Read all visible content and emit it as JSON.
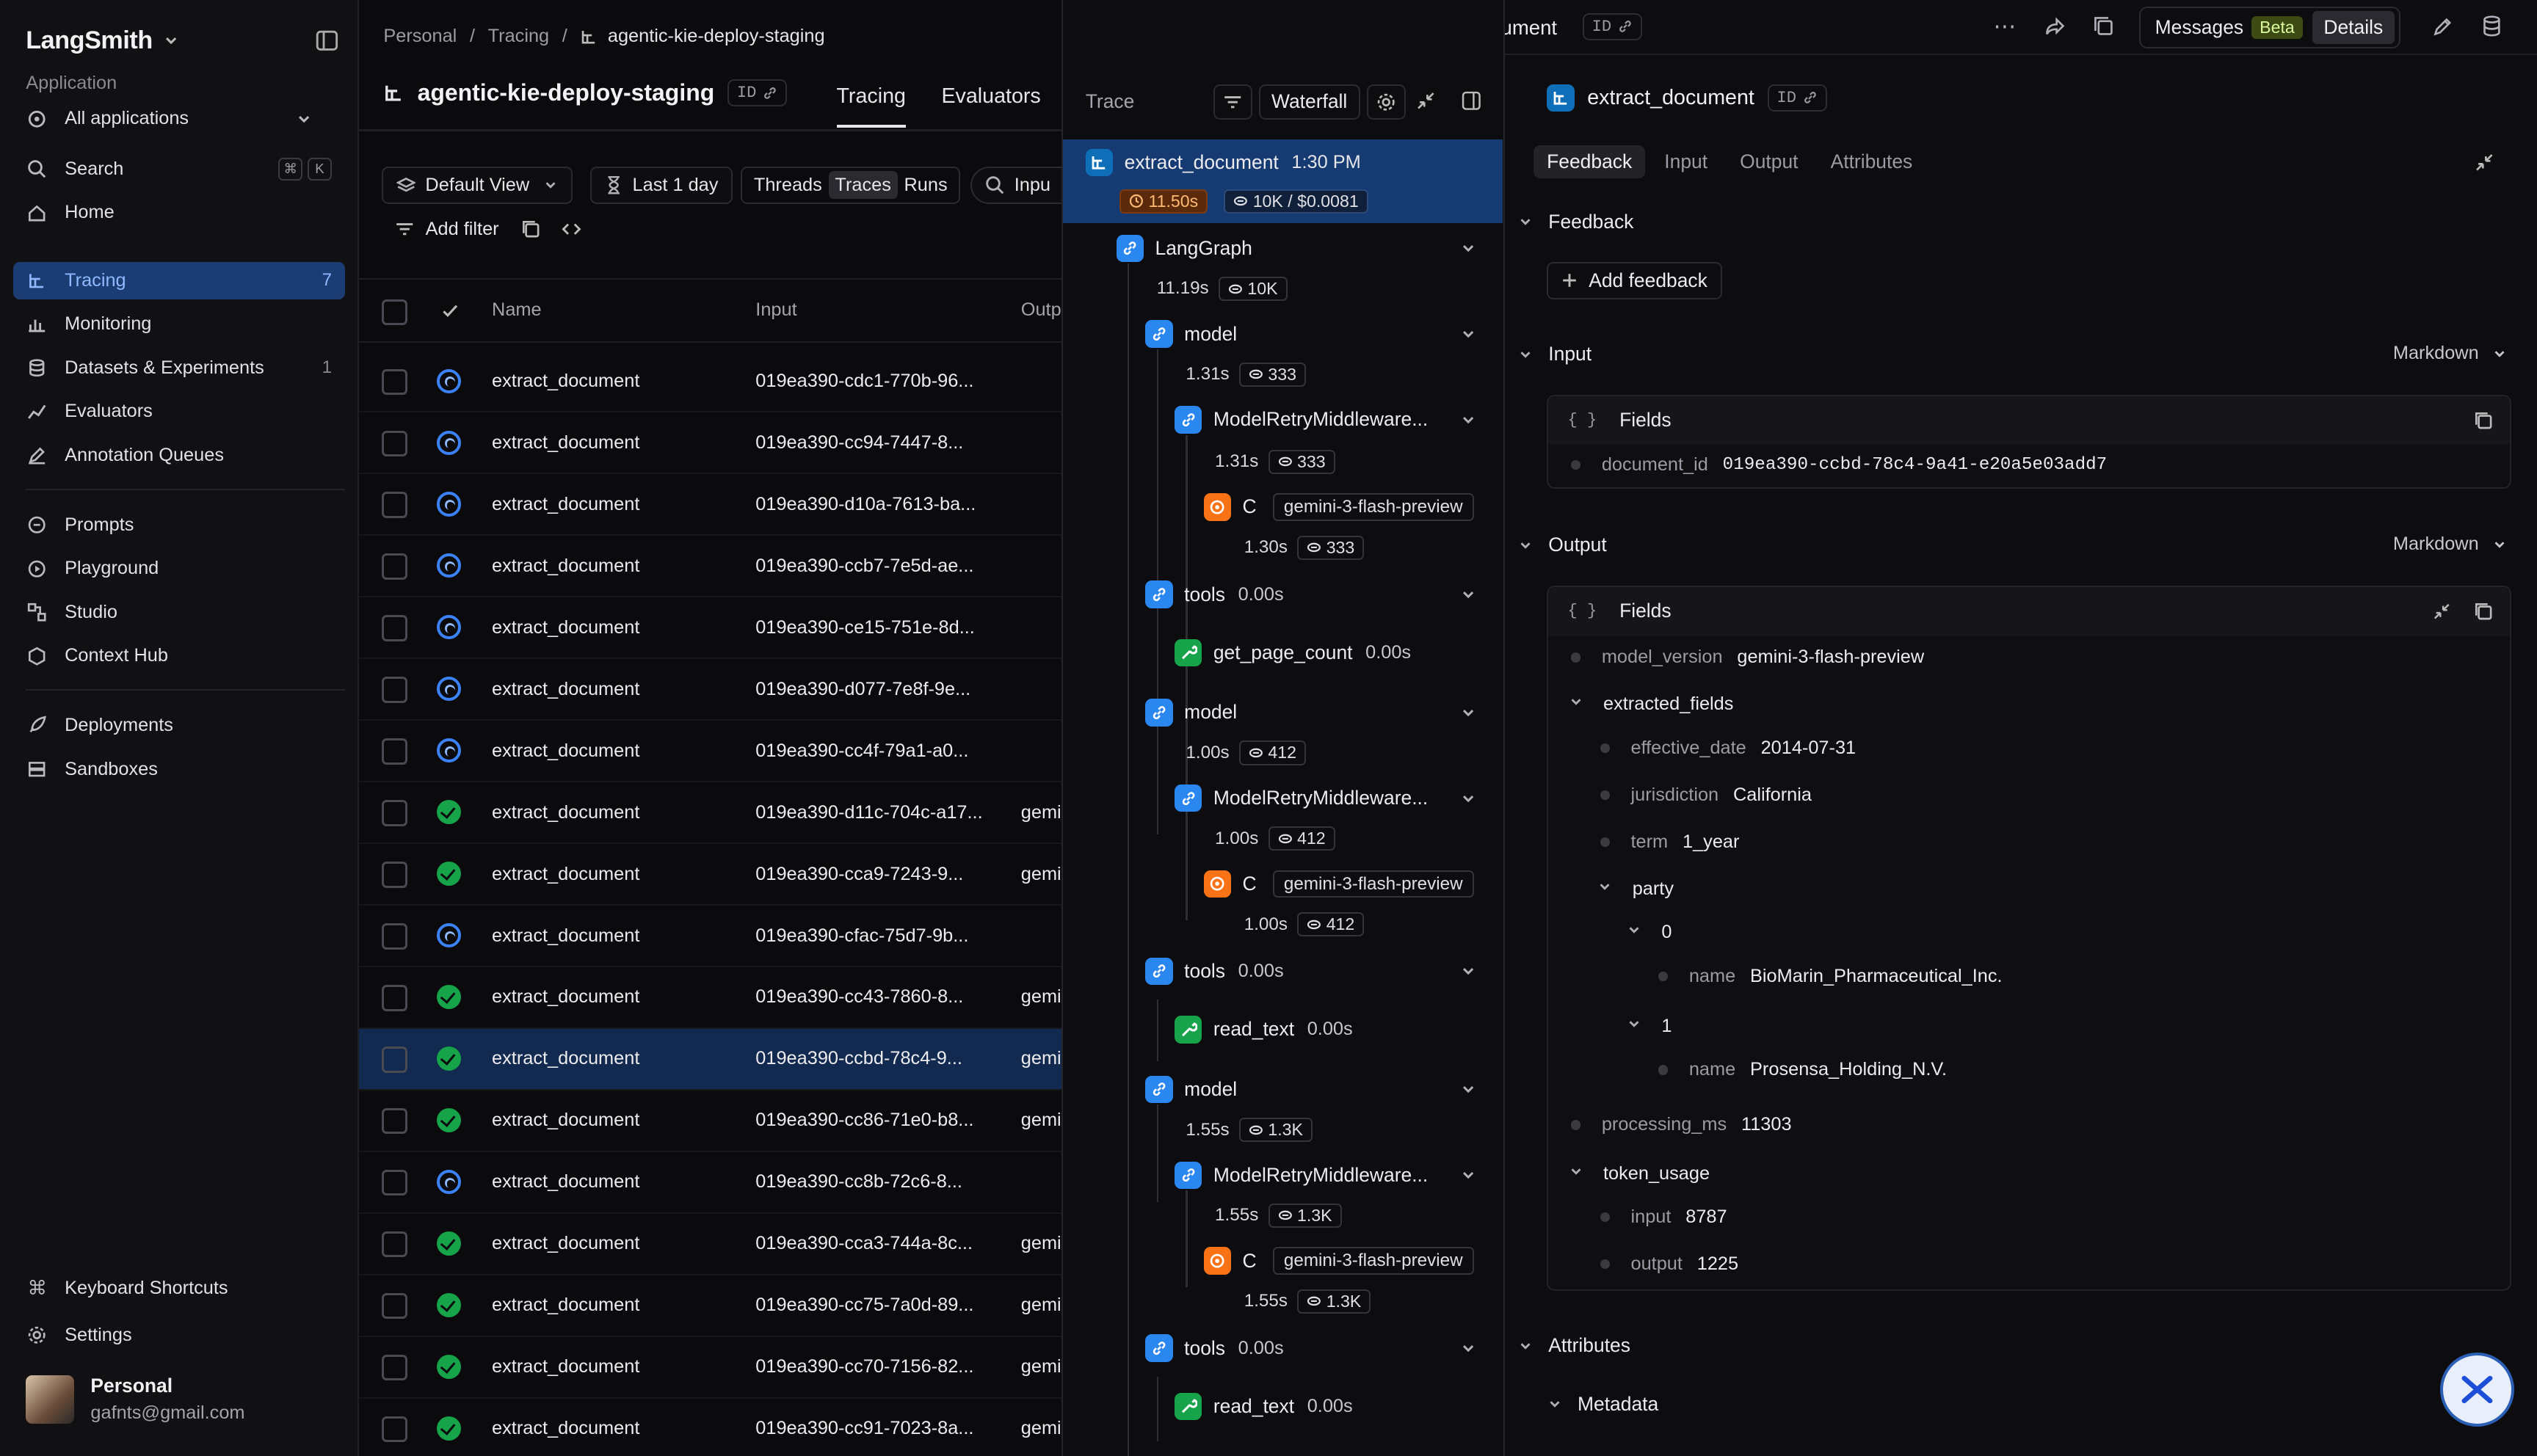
{
  "sidebar": {
    "logo": "LangSmith",
    "section_label": "Application",
    "app_select": "All applications",
    "search": "Search",
    "kbd": [
      "⌘",
      "K"
    ],
    "items": [
      {
        "label": "Home",
        "icon": "home-icon"
      },
      {
        "label": "Tracing",
        "icon": "tracing-icon",
        "count": "7",
        "active": true
      },
      {
        "label": "Monitoring",
        "icon": "chart-icon"
      },
      {
        "label": "Datasets & Experiments",
        "icon": "database-icon",
        "count": "1"
      },
      {
        "label": "Evaluators",
        "icon": "evaluators-icon"
      },
      {
        "label": "Annotation Queues",
        "icon": "pen-icon"
      },
      {
        "label": "Prompts",
        "icon": "chat-icon"
      },
      {
        "label": "Playground",
        "icon": "playground-icon"
      },
      {
        "label": "Studio",
        "icon": "studio-icon"
      },
      {
        "label": "Context Hub",
        "icon": "hub-icon"
      },
      {
        "label": "Deployments",
        "icon": "rocket-icon"
      },
      {
        "label": "Sandboxes",
        "icon": "sandbox-icon"
      }
    ],
    "footer": [
      {
        "label": "Keyboard Shortcuts",
        "icon": "command-icon"
      },
      {
        "label": "Settings",
        "icon": "gear-icon"
      }
    ],
    "user": {
      "name": "Personal",
      "email": "gafnts@gmail.com"
    }
  },
  "main": {
    "breadcrumb": [
      "Personal",
      "/",
      "Tracing",
      "/",
      "agentic-kie-deploy-staging"
    ],
    "project_title": "agentic-kie-deploy-staging",
    "id_badge": "ID",
    "tabs": [
      "Tracing",
      "Evaluators"
    ],
    "toolbar": {
      "view": "Default View",
      "time": "Last 1 day",
      "segments": [
        "Threads",
        "Traces",
        "Runs"
      ],
      "input_placeholder": "Inpu",
      "add_filter": "Add filter"
    },
    "columns": [
      "Name",
      "Input",
      "Outp"
    ],
    "rows": [
      {
        "status": "running",
        "name": "extract_document",
        "input": "019ea390-cdc1-770b-96...",
        "output": ""
      },
      {
        "status": "running",
        "name": "extract_document",
        "input": "019ea390-cc94-7447-8...",
        "output": ""
      },
      {
        "status": "running",
        "name": "extract_document",
        "input": "019ea390-d10a-7613-ba...",
        "output": ""
      },
      {
        "status": "running",
        "name": "extract_document",
        "input": "019ea390-ccb7-7e5d-ae...",
        "output": ""
      },
      {
        "status": "running",
        "name": "extract_document",
        "input": "019ea390-ce15-751e-8d...",
        "output": ""
      },
      {
        "status": "running",
        "name": "extract_document",
        "input": "019ea390-d077-7e8f-9e...",
        "output": ""
      },
      {
        "status": "running",
        "name": "extract_document",
        "input": "019ea390-cc4f-79a1-a0...",
        "output": ""
      },
      {
        "status": "success",
        "name": "extract_document",
        "input": "019ea390-d11c-704c-a17...",
        "output": "gemi"
      },
      {
        "status": "success",
        "name": "extract_document",
        "input": "019ea390-cca9-7243-9...",
        "output": "gemi"
      },
      {
        "status": "running",
        "name": "extract_document",
        "input": "019ea390-cfac-75d7-9b...",
        "output": ""
      },
      {
        "status": "success",
        "name": "extract_document",
        "input": "019ea390-cc43-7860-8...",
        "output": "gemi"
      },
      {
        "status": "success",
        "name": "extract_document",
        "input": "019ea390-ccbd-78c4-9...",
        "output": "gemi",
        "selected": true
      },
      {
        "status": "success",
        "name": "extract_document",
        "input": "019ea390-cc86-71e0-b8...",
        "output": "gemi"
      },
      {
        "status": "running",
        "name": "extract_document",
        "input": "019ea390-cc8b-72c6-8...",
        "output": ""
      },
      {
        "status": "success",
        "name": "extract_document",
        "input": "019ea390-cca3-744a-8c...",
        "output": "gemi"
      },
      {
        "status": "success",
        "name": "extract_document",
        "input": "019ea390-cc75-7a0d-89...",
        "output": "gemi"
      },
      {
        "status": "success",
        "name": "extract_document",
        "input": "019ea390-cc70-7156-82...",
        "output": "gemi"
      },
      {
        "status": "success",
        "name": "extract_document",
        "input": "019ea390-cc91-7023-8a...",
        "output": "gemi"
      }
    ]
  },
  "topbar": {
    "run_name": "extract_document",
    "id_badge": "ID",
    "messages": "Messages",
    "beta": "Beta",
    "details": "Details"
  },
  "trace": {
    "label": "Trace",
    "view": "Waterfall",
    "root": {
      "name": "extract_document",
      "time": "1:30 PM",
      "latency": "11.50s",
      "tokens": "10K / $0.0081"
    },
    "nodes": [
      {
        "kind": "chain",
        "name": "LangGraph",
        "latency": "11.19s",
        "tokens": "10K"
      },
      {
        "kind": "chain",
        "name": "model",
        "latency": "1.31s",
        "tokens": "333"
      },
      {
        "kind": "chain",
        "name": "ModelRetryMiddleware...",
        "latency": "1.31s",
        "tokens": "333"
      },
      {
        "kind": "llm",
        "name": "C",
        "model": "gemini-3-flash-preview",
        "latency": "1.30s",
        "tokens": "333"
      },
      {
        "kind": "chain",
        "name": "tools",
        "duration": "0.00s"
      },
      {
        "kind": "tool",
        "name": "get_page_count",
        "duration": "0.00s"
      },
      {
        "kind": "chain",
        "name": "model",
        "latency": "1.00s",
        "tokens": "412"
      },
      {
        "kind": "chain",
        "name": "ModelRetryMiddleware...",
        "latency": "1.00s",
        "tokens": "412"
      },
      {
        "kind": "llm",
        "name": "C",
        "model": "gemini-3-flash-preview",
        "latency": "1.00s",
        "tokens": "412"
      },
      {
        "kind": "chain",
        "name": "tools",
        "duration": "0.00s"
      },
      {
        "kind": "tool",
        "name": "read_text",
        "duration": "0.00s"
      },
      {
        "kind": "chain",
        "name": "model",
        "latency": "1.55s",
        "tokens": "1.3K"
      },
      {
        "kind": "chain",
        "name": "ModelRetryMiddleware...",
        "latency": "1.55s",
        "tokens": "1.3K"
      },
      {
        "kind": "llm",
        "name": "C",
        "model": "gemini-3-flash-preview",
        "latency": "1.55s",
        "tokens": "1.3K"
      },
      {
        "kind": "chain",
        "name": "tools",
        "duration": "0.00s"
      },
      {
        "kind": "tool",
        "name": "read_text",
        "duration": "0.00s"
      }
    ]
  },
  "details": {
    "title": "extract_document",
    "id_badge": "ID",
    "tabs": [
      "Feedback",
      "Input",
      "Output",
      "Attributes"
    ],
    "feedback": {
      "section": "Feedback",
      "add": "Add feedback"
    },
    "input": {
      "section": "Input",
      "format": "Markdown",
      "card": "Fields",
      "document_id_key": "document_id",
      "document_id": "019ea390-ccbd-78c4-9a41-e20a5e03add7"
    },
    "output": {
      "section": "Output",
      "format": "Markdown",
      "card": "Fields",
      "model_version_key": "model_version",
      "model_version": "gemini-3-flash-preview",
      "extracted_fields": "extracted_fields",
      "effective_date_key": "effective_date",
      "effective_date": "2014-07-31",
      "jurisdiction_key": "jurisdiction",
      "jurisdiction": "California",
      "term_key": "term",
      "term": "1_year",
      "party": "party",
      "p0": "0",
      "p0_name_key": "name",
      "p0_name": "BioMarin_Pharmaceutical_Inc.",
      "p1": "1",
      "p1_name_key": "name",
      "p1_name": "Prosensa_Holding_N.V.",
      "processing_ms_key": "processing_ms",
      "processing_ms": "11303",
      "token_usage": "token_usage",
      "input_key": "input",
      "input_val": "8787",
      "output_key": "output",
      "output_val": "1225"
    },
    "attributes": {
      "section": "Attributes",
      "metadata": "Metadata"
    }
  },
  "colors": {
    "accent": "#3b82f6",
    "selected_row": "#122a4f",
    "success": "#16a34a",
    "llm": "#f97316"
  }
}
